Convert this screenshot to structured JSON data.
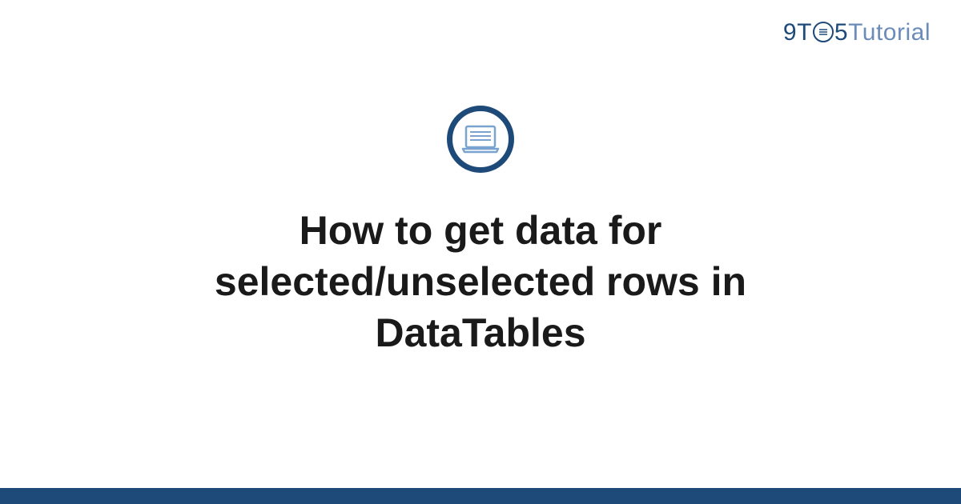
{
  "brand": {
    "part_9": "9",
    "part_t1": "T",
    "part_5": "5",
    "part_tutorial": "Tutorial"
  },
  "article": {
    "title": "How to get data for selected/unselected rows in DataTables"
  },
  "colors": {
    "primary": "#1e4a7a",
    "secondary": "#6b8cb8"
  }
}
